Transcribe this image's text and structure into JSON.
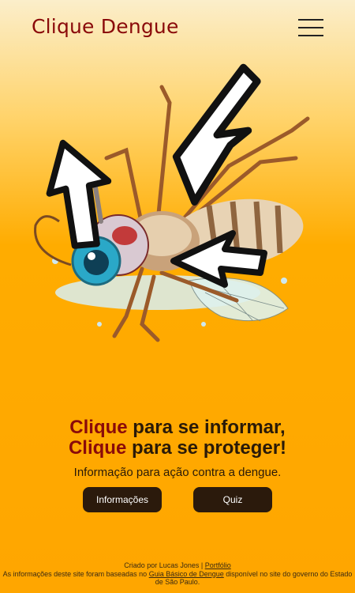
{
  "header": {
    "brand": "Clique Dengue",
    "menu_icon": "hamburger-menu-icon"
  },
  "hero": {
    "illustration": "mosquito-with-cursor-arrows",
    "icons": [
      "cursor-arrow-icon",
      "cursor-arrow-icon",
      "cursor-arrow-icon"
    ]
  },
  "headline": {
    "line1_accent": "Clique",
    "line1_rest": " para se informar,",
    "line2_accent": "Clique",
    "line2_rest": " para se proteger!"
  },
  "tagline": "Informação para ação contra a dengue.",
  "buttons": {
    "info_label": "Informações",
    "quiz_label": "Quiz"
  },
  "footer": {
    "credit_prefix": "Criado por Lucas Jones | ",
    "portfolio_link": "Portfólio",
    "source_prefix": "As informações deste site foram baseadas no ",
    "guide_link": "Guia Básico de Dengue",
    "source_suffix": " disponível no site do governo do Estado de São Paulo."
  },
  "colors": {
    "accent": "#8a0a0a",
    "button_bg": "#2b1a0c",
    "background_top": "#fbeeca",
    "background_bottom": "#ffa600"
  }
}
